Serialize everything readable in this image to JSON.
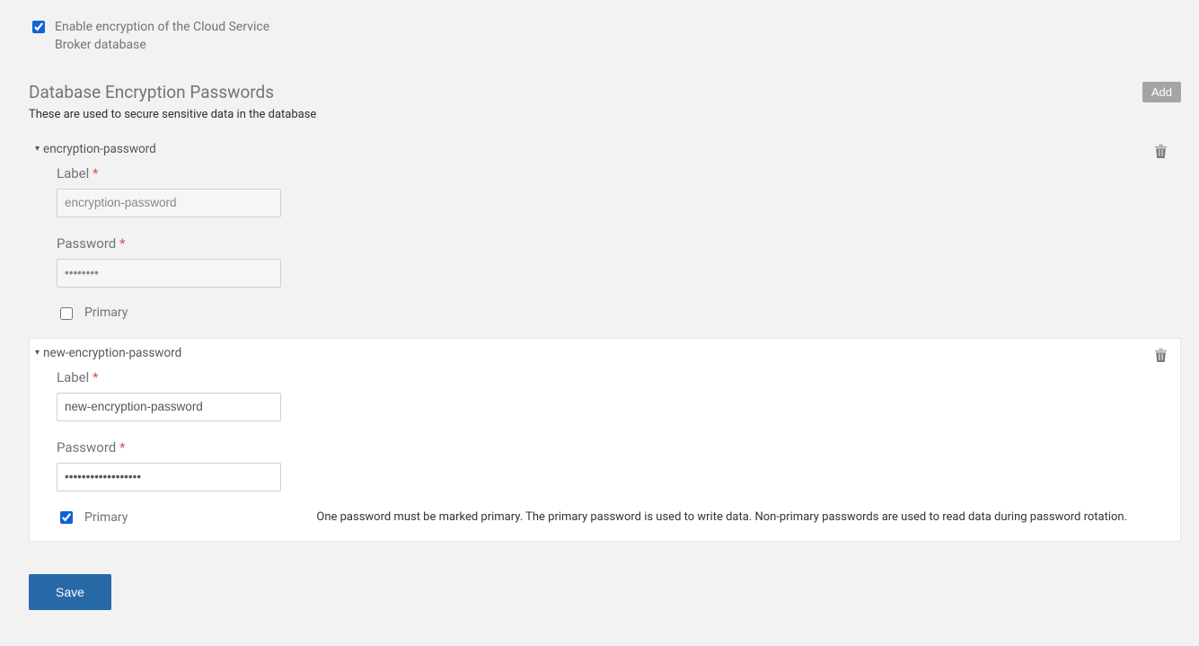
{
  "top": {
    "enable_label": "Enable encryption of the Cloud Service Broker database",
    "checked": true
  },
  "section": {
    "title": "Database Encryption Passwords",
    "subtitle": "These are used to secure sensitive data in the database",
    "add_label": "Add"
  },
  "labels": {
    "label_field": "Label",
    "password_field": "Password",
    "primary": "Primary"
  },
  "entries": [
    {
      "name": "encryption-password",
      "label_value": "encryption-password",
      "password_value": "••••••••",
      "primary": false,
      "active": false
    },
    {
      "name": "new-encryption-password",
      "label_value": "new-encryption-password",
      "password_value": "••••••••••••••••••",
      "primary": true,
      "active": true,
      "primary_note": "One password must be marked primary. The primary password is used to write data. Non-primary passwords are used to read data during password rotation."
    }
  ],
  "save_label": "Save"
}
